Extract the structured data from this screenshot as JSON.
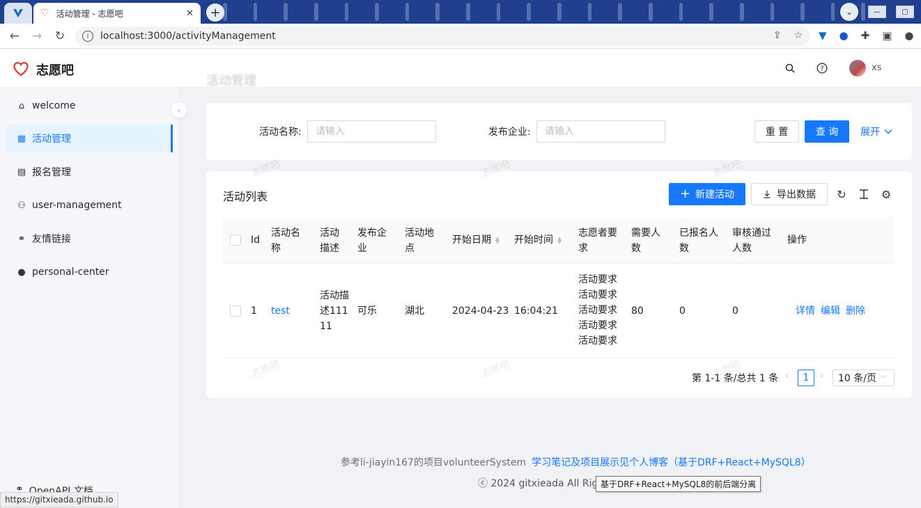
{
  "browser": {
    "tab_title": "活动管理 - 志愿吧",
    "tab_close": "✕",
    "new_tab": "+",
    "url": "localhost:3000/activityManagement",
    "status_url": "https://gitxieada.github.io"
  },
  "app": {
    "logo_text": "志愿吧",
    "page_title": "活动管理",
    "user_name": "xs"
  },
  "sidebar": {
    "items": [
      {
        "label": "welcome",
        "icon": "home-icon"
      },
      {
        "label": "活动管理",
        "icon": "appstore-icon",
        "active": true
      },
      {
        "label": "报名管理",
        "icon": "form-icon"
      },
      {
        "label": "user-management",
        "icon": "user-icon"
      },
      {
        "label": "友情链接",
        "icon": "link-icon"
      },
      {
        "label": "personal-center",
        "icon": "user-icon"
      }
    ],
    "openapi_label": "OpenAPI 文档"
  },
  "search": {
    "activity_name_label": "活动名称:",
    "activity_name_placeholder": "请输入",
    "company_label": "发布企业:",
    "company_placeholder": "请输入",
    "reset_label": "重 置",
    "query_label": "查 询",
    "expand_label": "展开"
  },
  "table": {
    "title": "活动列表",
    "new_button": "新建活动",
    "export_button": "导出数据",
    "columns": {
      "id": "Id",
      "name": "活动名称",
      "desc": "活动描述",
      "company": "发布企业",
      "location": "活动地点",
      "start_date": "开始日期",
      "start_time": "开始时间",
      "requirement": "志愿者要求",
      "need_count": "需要人数",
      "signed_count": "已报名人数",
      "approved_count": "审核通过人数",
      "actions": "操作"
    },
    "rows": [
      {
        "id": "1",
        "name": "test",
        "desc": "活动描述11111",
        "company": "可乐",
        "location": "湖北",
        "start_date": "2024-04-23",
        "start_time": "16:04:21",
        "requirement": "活动要求活动要求活动要求活动要求活动要求",
        "need_count": "80",
        "signed_count": "0",
        "approved_count": "0",
        "action_detail": "详情",
        "action_edit": "编辑",
        "action_delete": "删除"
      }
    ],
    "pagination": {
      "total_text": "第 1-1 条/总共 1 条",
      "current_page": "1",
      "page_size": "10 条/页"
    }
  },
  "watermark": "志愿吧",
  "footer": {
    "reference_text": "参考li-jiayin167的项目volunteerSystem",
    "blog_link": "学习笔记及项目展示见个人博客（基于DRF+React+MySQL8）",
    "copyright": "ⓒ 2024 gitxieada All Rights",
    "tooltip": "基于DRF+React+MySQL8的前后端分离"
  },
  "colors": {
    "primary": "#1677ff",
    "logo_red": "#e23c3c",
    "tab_strip": "#1f3f8f"
  }
}
